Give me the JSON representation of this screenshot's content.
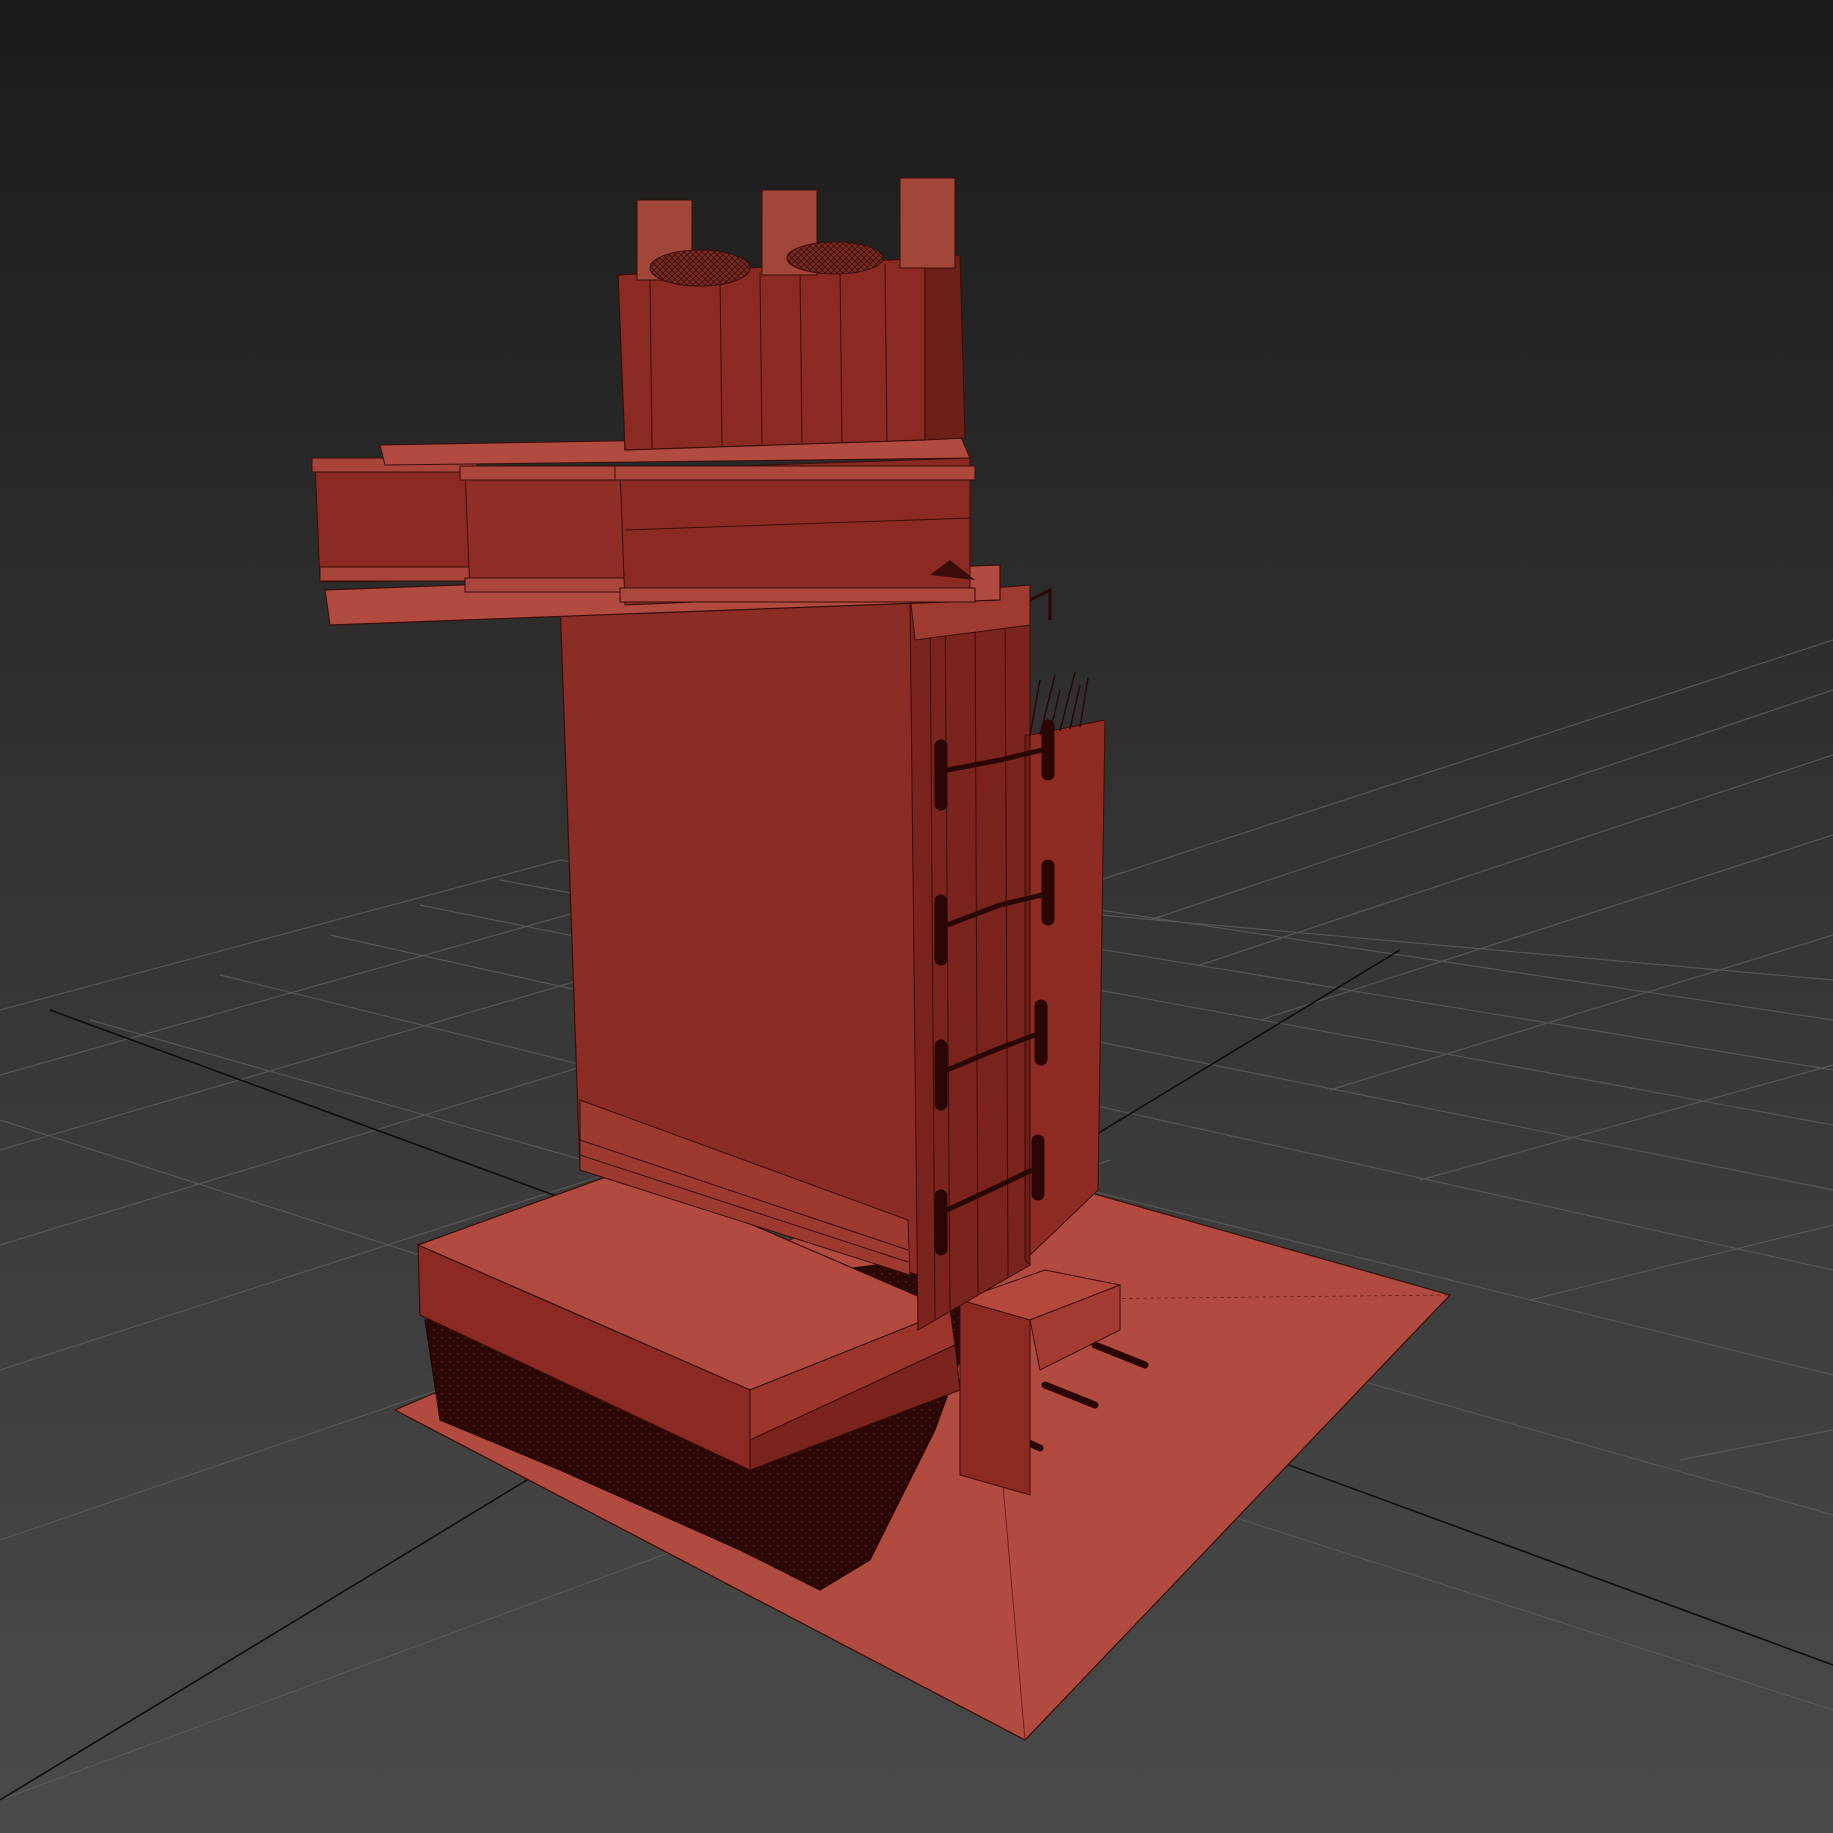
{
  "viewport": {
    "active_border_color": "#b8a53a",
    "background_top_color": "#1b1b1b",
    "background_bottom_color": "#4a4a4a",
    "grid_line_color": "#5a5a5a",
    "grid_axis_color": "#101010",
    "selection_color": "#a3463a"
  },
  "scene": {
    "object_type": "foundation-wall-section",
    "display_mode": "shaded-with-edged-faces",
    "selected": true
  }
}
